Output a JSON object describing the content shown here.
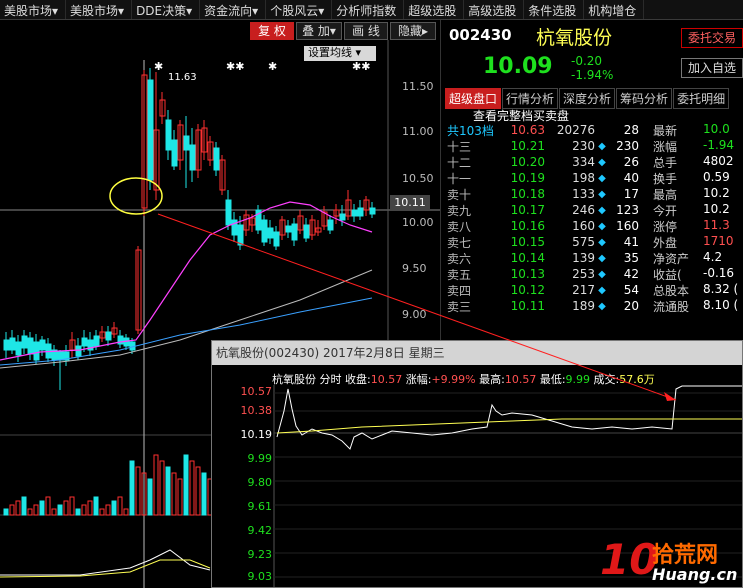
{
  "menu": [
    "美股市场▾",
    "美股市场▾",
    "DDE决策▾",
    "资金流向▾",
    "个股风云▾",
    "分析师指数",
    "超级选股",
    "高级选股",
    "条件选股",
    "机构增仓"
  ],
  "toolbar": {
    "restore": "复 权",
    "overlay": "叠 加▾",
    "draw": "画 线",
    "hide": "隐藏▸",
    "ma_setting": "设置均线 ▾"
  },
  "kline": {
    "high_label": "11.63",
    "price_ticks": [
      "11.50",
      "11.00",
      "10.50",
      "10.00",
      "9.50",
      "9.00"
    ],
    "current_price": "10.11"
  },
  "quote": {
    "code": "002430",
    "name": "杭氧股份",
    "price": "10.09",
    "change": "-0.20",
    "change_pct": "-1.94%",
    "trade_button": "委托交易",
    "add_fav": "加入自选"
  },
  "tabs": [
    "超级盘口",
    "行情分析",
    "深度分析",
    "筹码分析",
    "委托明细"
  ],
  "orderbook_title": "查看完整档买卖盘",
  "orderbook": [
    {
      "label": "共103档",
      "price": "10.63",
      "vol": "20276",
      "dia": "",
      "count": "28",
      "top": true
    },
    {
      "label": "十三",
      "price": "10.21",
      "vol": "230",
      "dia": "◆",
      "count": "230"
    },
    {
      "label": "十二",
      "price": "10.20",
      "vol": "334",
      "dia": "◆",
      "count": "26"
    },
    {
      "label": "十一",
      "price": "10.19",
      "vol": "198",
      "dia": "◆",
      "count": "40"
    },
    {
      "label": "卖十",
      "price": "10.18",
      "vol": "133",
      "dia": "◆",
      "count": "17"
    },
    {
      "label": "卖九",
      "price": "10.17",
      "vol": "246",
      "dia": "◆",
      "count": "123"
    },
    {
      "label": "卖八",
      "price": "10.16",
      "vol": "160",
      "dia": "◆",
      "count": "160"
    },
    {
      "label": "卖七",
      "price": "10.15",
      "vol": "575",
      "dia": "◆",
      "count": "41"
    },
    {
      "label": "卖六",
      "price": "10.14",
      "vol": "139",
      "dia": "◆",
      "count": "35"
    },
    {
      "label": "卖五",
      "price": "10.13",
      "vol": "253",
      "dia": "◆",
      "count": "42"
    },
    {
      "label": "卖四",
      "price": "10.12",
      "vol": "217",
      "dia": "◆",
      "count": "54"
    },
    {
      "label": "卖三",
      "price": "10.11",
      "vol": "189",
      "dia": "◆",
      "count": "20"
    }
  ],
  "stats": [
    {
      "k": "最新",
      "v": "10.0",
      "c": "v"
    },
    {
      "k": "涨幅",
      "v": "-1.94",
      "c": "v"
    },
    {
      "k": "总手",
      "v": "4802",
      "c": "v w"
    },
    {
      "k": "换手",
      "v": "0.59",
      "c": "v w"
    },
    {
      "k": "最高",
      "v": "10.2",
      "c": "v w"
    },
    {
      "k": "今开",
      "v": "10.2",
      "c": "v w"
    },
    {
      "k": "涨停",
      "v": "11.3",
      "c": "v red"
    },
    {
      "k": "外盘",
      "v": "1710",
      "c": "v red"
    },
    {
      "k": "净资产",
      "v": "4.2",
      "c": "v w"
    },
    {
      "k": "收益(",
      "v": "-0.16",
      "c": "v w"
    },
    {
      "k": "总股本",
      "v": "8.32 (",
      "c": "v w"
    },
    {
      "k": "流通股",
      "v": "8.10 (",
      "c": "v w"
    }
  ],
  "popup": {
    "title": "杭氧股份(002430) 2017年2月8日 星期三",
    "name": "杭氧股份",
    "mode": "分时",
    "close_label": "收盘:",
    "close": "10.57",
    "pct_label": "涨幅:",
    "pct": "+9.99%",
    "high_label": "最高:",
    "high": "10.57",
    "low_label": "最低:",
    "low": "9.99",
    "vol_label": "成交:",
    "vol": "57.6万",
    "yticks": [
      "10.57",
      "10.38",
      "10.19",
      "9.99",
      "9.80",
      "9.61",
      "9.42",
      "9.23",
      "9.03"
    ]
  },
  "watermark": {
    "ten": "10",
    "cn": "拾荒网",
    "url": "Huang.cn"
  },
  "colors": {
    "up": "#ff3030",
    "down": "#1ee6e6",
    "ma5": "#ffffff",
    "ma10": "#ffff54",
    "ma20": "#ff40ff",
    "ma60": "#1ee01e",
    "ma120": "#3aa0ff"
  }
}
